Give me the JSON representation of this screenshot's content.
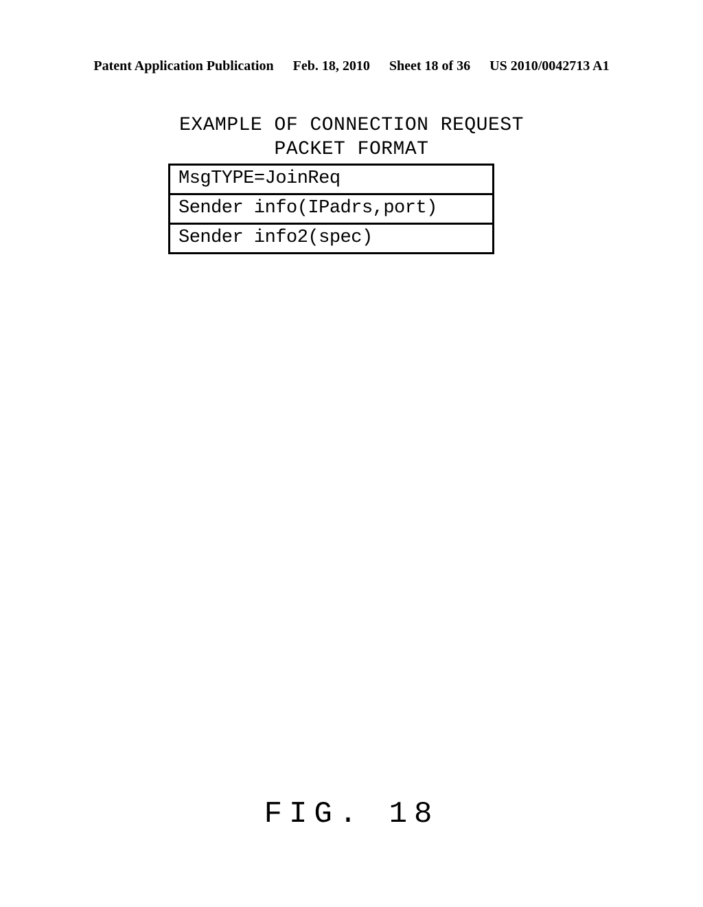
{
  "header": {
    "publication_type": "Patent Application Publication",
    "date": "Feb. 18, 2010",
    "sheet": "Sheet 18 of 36",
    "publication_number": "US 2010/0042713 A1"
  },
  "diagram": {
    "title_line1": "EXAMPLE OF CONNECTION REQUEST",
    "title_line2": "PACKET FORMAT",
    "rows": [
      "MsgTYPE=JoinReq",
      "Sender info(IPadrs,port)",
      "Sender info2(spec)"
    ]
  },
  "figure_label": "FIG. 18"
}
